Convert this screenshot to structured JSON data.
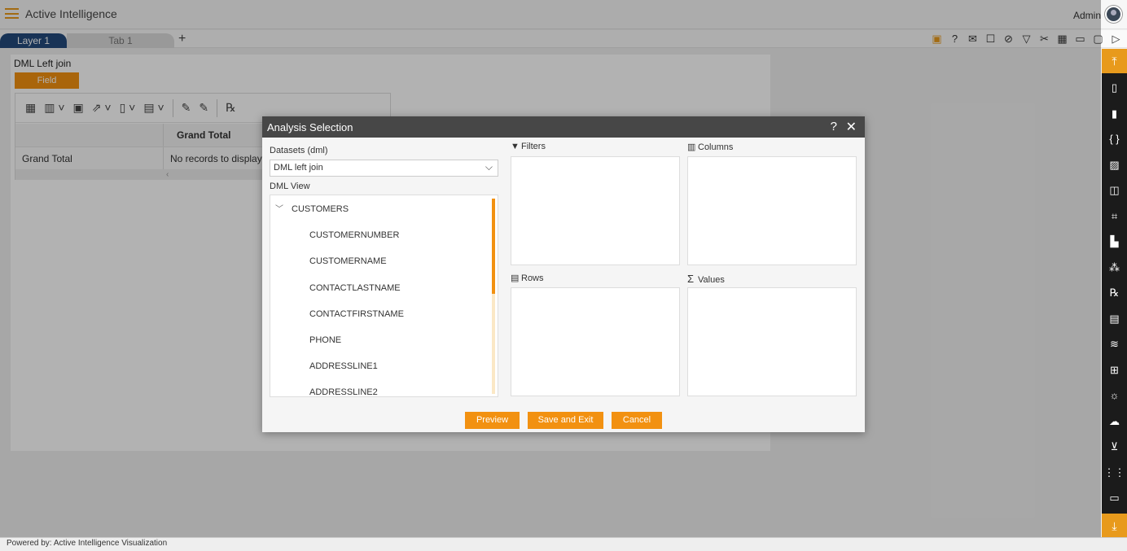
{
  "header": {
    "app_title": "Active Intelligence",
    "user": "Admin"
  },
  "tabs": [
    {
      "label": "Layer 1"
    },
    {
      "label": "Tab 1"
    }
  ],
  "tab_add": "+",
  "canvas": {
    "panel_title": "DML Left join",
    "field_button": "Field",
    "pivot": {
      "column_header": "Grand Total",
      "row_label": "Grand Total",
      "empty_message": "No records to display",
      "scroll_hint": "‹"
    }
  },
  "modal": {
    "title": "Analysis Selection",
    "datasets_label": "Datasets (dml)",
    "selected_dataset": "DML left join",
    "view_label": "DML View",
    "tree": {
      "root": "CUSTOMERS",
      "fields": [
        "CUSTOMERNUMBER",
        "CUSTOMERNAME",
        "CONTACTLASTNAME",
        "CONTACTFIRSTNAME",
        "PHONE",
        "ADDRESSLINE1",
        "ADDRESSLINE2"
      ]
    },
    "zones": {
      "filters": "Filters",
      "columns": "Columns",
      "rows": "Rows",
      "values": "Values"
    },
    "buttons": {
      "preview": "Preview",
      "save_exit": "Save and Exit",
      "cancel": "Cancel"
    }
  },
  "footer": {
    "text": "Powered by: Active Intelligence Visualization"
  },
  "colors": {
    "accent": "#f29111",
    "header_dark": "#474747",
    "tab_active": "#234a7c",
    "sidebar": "#1b1b1b"
  }
}
